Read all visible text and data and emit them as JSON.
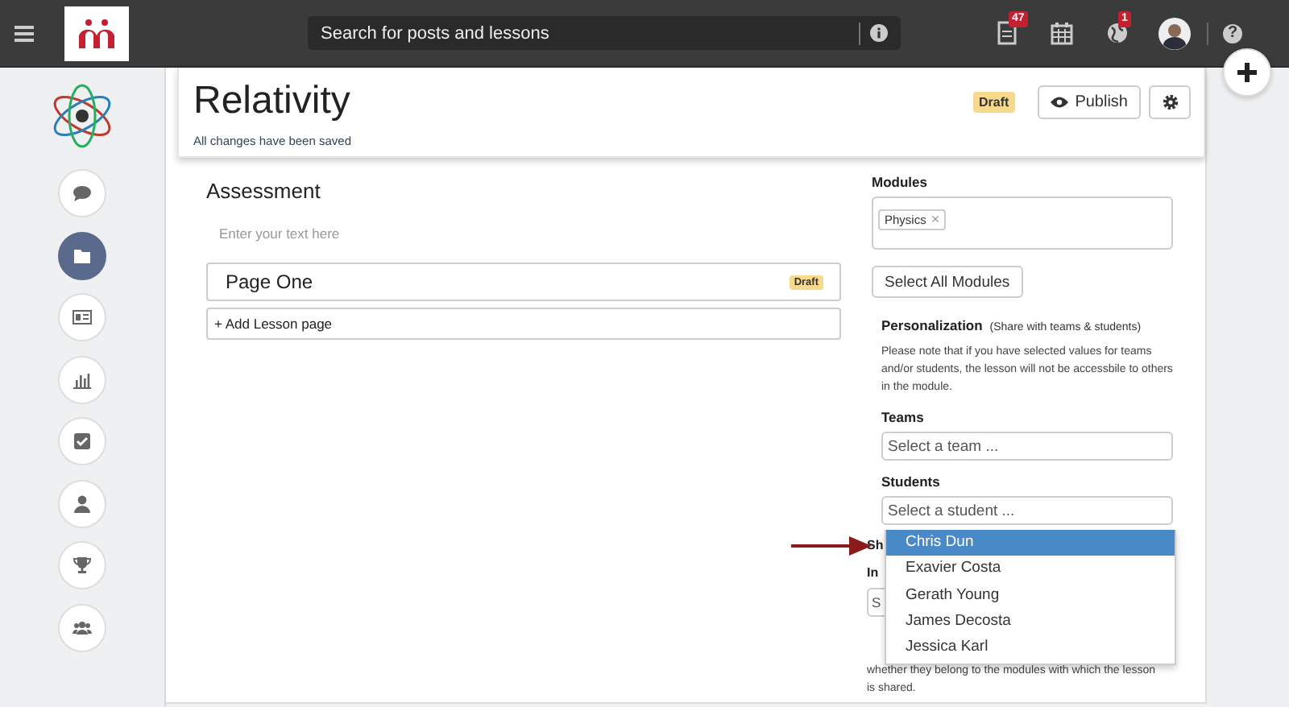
{
  "top_bar": {
    "search": {
      "placeholder": "Search for posts and lessons"
    },
    "notifications": [
      {
        "kind": "document",
        "badge": "47"
      },
      {
        "kind": "calendar"
      },
      {
        "kind": "globe",
        "badge": "1"
      }
    ],
    "help": "?"
  },
  "sidebar": {
    "items": [
      {
        "kind": "chat",
        "selected": false
      },
      {
        "kind": "folder",
        "selected": true
      },
      {
        "kind": "card",
        "selected": false
      },
      {
        "kind": "chart",
        "selected": false
      },
      {
        "kind": "check",
        "selected": false
      },
      {
        "kind": "user",
        "selected": false
      },
      {
        "kind": "trophy",
        "selected": false
      },
      {
        "kind": "group",
        "selected": false
      }
    ]
  },
  "header": {
    "title": "Relativity",
    "status": "Draft",
    "save_note": "All changes have been saved",
    "publish": "Publish"
  },
  "lesson": {
    "heading": "Assessment",
    "placeholder": "Enter your text here",
    "pages": [
      {
        "title": "Page One",
        "status": "Draft"
      }
    ],
    "add_page": "+ Add Lesson page"
  },
  "settings": {
    "modules_label": "Modules",
    "modules": [
      {
        "name": "Physics",
        "remove": "×"
      }
    ],
    "select_all": "Select All Modules",
    "personalization": {
      "title": "Personalization",
      "subtitle": "(Share with teams & students)",
      "note": "Please note that if you have selected values for teams and/or students, the lesson will not be accessbile to others in the module."
    },
    "teams": {
      "label": "Teams",
      "placeholder": "Select a team ..."
    },
    "students": {
      "label": "Students",
      "placeholder": "Select a student ...",
      "options": [
        {
          "name": "Chris Dun",
          "selected": true
        },
        {
          "name": "Exavier Costa",
          "selected": false
        },
        {
          "name": "Gerath Young",
          "selected": false
        },
        {
          "name": "James Decosta",
          "selected": false
        },
        {
          "name": "Jessica Karl",
          "selected": false
        }
      ]
    },
    "hidden_label_1": "Sh",
    "hidden_label_2": "In",
    "hidden_field": "S",
    "hidden_note_end": "whether they belong to the modules with which the lesson is shared."
  }
}
